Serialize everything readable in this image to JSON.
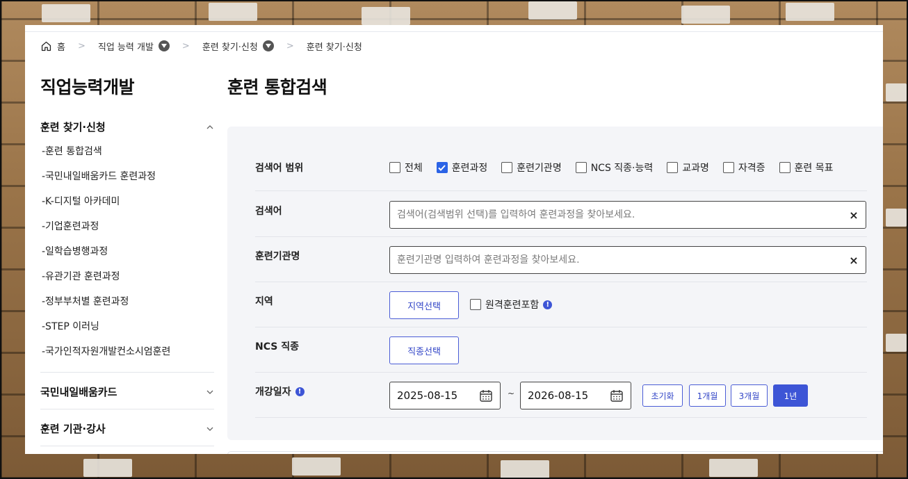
{
  "breadcrumb": {
    "home": "홈",
    "level1": "직업 능력 개발",
    "level2": "훈련 찾기·신청",
    "level3": "훈련 찾기·신청"
  },
  "sidebar": {
    "title": "직업능력개발",
    "groups": [
      {
        "label": "훈련 찾기·신청",
        "expanded": true,
        "items": [
          "-훈련 통합검색",
          "-국민내일배움카드 훈련과정",
          "-K-디지털 아카데미",
          "-기업훈련과정",
          "-일학습병행과정",
          "-유관기관 훈련과정",
          "-정부부처별 훈련과정",
          "-STEP 이러닝",
          "-국가인적자원개발컨소시엄훈련"
        ]
      },
      {
        "label": "국민내일배움카드",
        "expanded": false
      },
      {
        "label": "훈련 기관·강사",
        "expanded": false
      }
    ]
  },
  "main": {
    "title": "훈련 통합검색",
    "scope": {
      "label": "검색어 범위",
      "options": [
        {
          "label": "전체",
          "checked": false
        },
        {
          "label": "훈련과정",
          "checked": true
        },
        {
          "label": "훈련기관명",
          "checked": false
        },
        {
          "label": "NCS 직종·능력",
          "checked": false
        },
        {
          "label": "교과명",
          "checked": false
        },
        {
          "label": "자격증",
          "checked": false
        },
        {
          "label": "훈련 목표",
          "checked": false
        }
      ]
    },
    "keyword": {
      "label": "검색어",
      "placeholder": "검색어(검색범위 선택)를 입력하여 훈련과정을 찾아보세요.",
      "value": ""
    },
    "institution": {
      "label": "훈련기관명",
      "placeholder": "훈련기관명 입력하여 훈련과정을 찾아보세요.",
      "value": ""
    },
    "region": {
      "label": "지역",
      "button": "지역선택",
      "remote_label": "원격훈련포함",
      "remote_checked": false
    },
    "ncs": {
      "label": "NCS 직종",
      "button": "직종선택"
    },
    "period": {
      "label": "개강일자",
      "start": "2025-08-15",
      "end": "2026-08-15",
      "separator": "~",
      "buttons": [
        {
          "label": "초기화",
          "active": false
        },
        {
          "label": "1개월",
          "active": false
        },
        {
          "label": "3개월",
          "active": false
        },
        {
          "label": "1년",
          "active": true
        }
      ]
    }
  },
  "colors": {
    "accent": "#3d55d6",
    "checkbox_checked": "#2b63e6",
    "search_bg": "#f4f5f8"
  }
}
